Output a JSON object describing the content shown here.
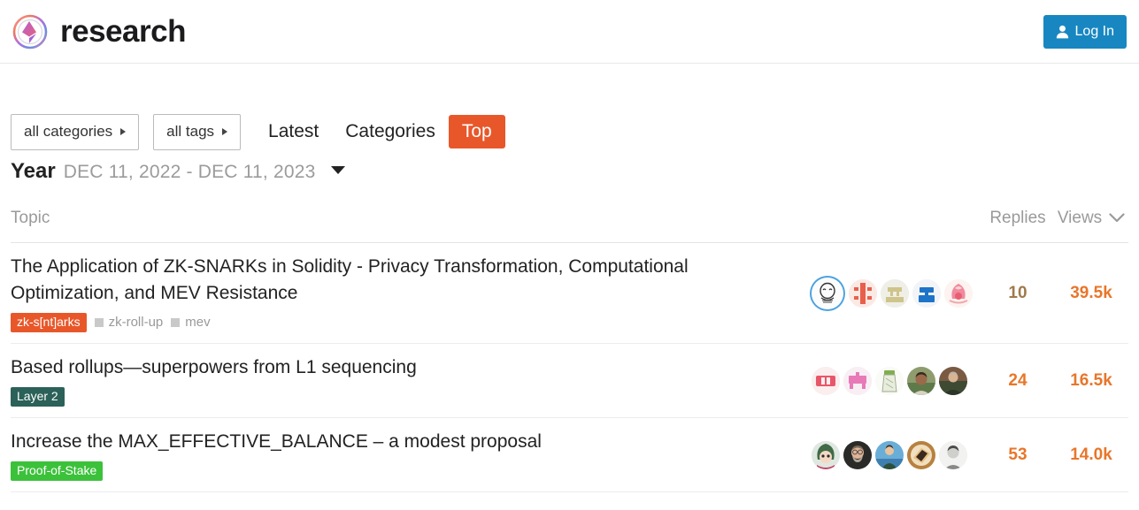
{
  "header": {
    "brand_title": "research",
    "logo_icon": "ethereum-circle-logo",
    "login_label": "Log In",
    "login_icon": "user-icon",
    "login_bg": "#1887c1"
  },
  "nav": {
    "categories_dropdown": "all categories",
    "tags_dropdown": "all tags",
    "links": [
      {
        "label": "Latest",
        "active": false
      },
      {
        "label": "Categories",
        "active": false
      },
      {
        "label": "Top",
        "active": true
      }
    ],
    "active_bg": "#e8572a"
  },
  "period": {
    "label": "Year",
    "range": "DEC 11, 2022 - DEC 11, 2023",
    "caret_icon": "caret-down-icon"
  },
  "table": {
    "headers": {
      "topic": "Topic",
      "replies": "Replies",
      "views": "Views"
    },
    "sort_icon": "chevron-down-icon",
    "rows": [
      {
        "title": "The Application of ZK-SNARKs in Solidity - Privacy Transformation, Computational Optimization, and MEV Resistance",
        "category": {
          "label": "zk-s[nt]arks",
          "color": "#e8572a"
        },
        "tags": [
          "zk-roll-up",
          "mev"
        ],
        "avatars": [
          {
            "name": "avatar-sketch-face",
            "style": "sketch",
            "ringed": true
          },
          {
            "name": "avatar-red-pattern",
            "style": "redpattern",
            "ringed": false
          },
          {
            "name": "avatar-khaki-pixel",
            "style": "khaki",
            "ringed": false
          },
          {
            "name": "avatar-blue-robot",
            "style": "blue",
            "ringed": false
          },
          {
            "name": "avatar-pink-anime",
            "style": "pink",
            "ringed": false
          }
        ],
        "replies": "10",
        "replies_hot": false,
        "views": "39.5k"
      },
      {
        "title": "Based rollups—superpowers from L1 sequencing",
        "category": {
          "label": "Layer 2",
          "color": "#2b6159"
        },
        "tags": [],
        "avatars": [
          {
            "name": "avatar-red-square",
            "style": "redsquare",
            "ringed": false
          },
          {
            "name": "avatar-pink-bot",
            "style": "pinkbot",
            "ringed": false
          },
          {
            "name": "avatar-green-sketch",
            "style": "greensketch",
            "ringed": false
          },
          {
            "name": "avatar-photo-man",
            "style": "photo1",
            "ringed": false
          },
          {
            "name": "avatar-photo-person",
            "style": "photo2",
            "ringed": false
          }
        ],
        "replies": "24",
        "replies_hot": true,
        "views": "16.5k"
      },
      {
        "title": "Increase the MAX_EFFECTIVE_BALANCE – a modest proposal",
        "category": {
          "label": "Proof-of-Stake",
          "color": "#3cc13b"
        },
        "tags": [],
        "avatars": [
          {
            "name": "avatar-anime-green",
            "style": "animegreen",
            "ringed": false
          },
          {
            "name": "avatar-photo-bearded",
            "style": "photo3",
            "ringed": false
          },
          {
            "name": "avatar-photo-beach",
            "style": "photo4",
            "ringed": false
          },
          {
            "name": "avatar-toast-plate",
            "style": "toast",
            "ringed": false
          },
          {
            "name": "avatar-grayscale-portrait",
            "style": "photo5",
            "ringed": false
          }
        ],
        "replies": "53",
        "replies_hot": true,
        "views": "14.0k"
      }
    ]
  }
}
